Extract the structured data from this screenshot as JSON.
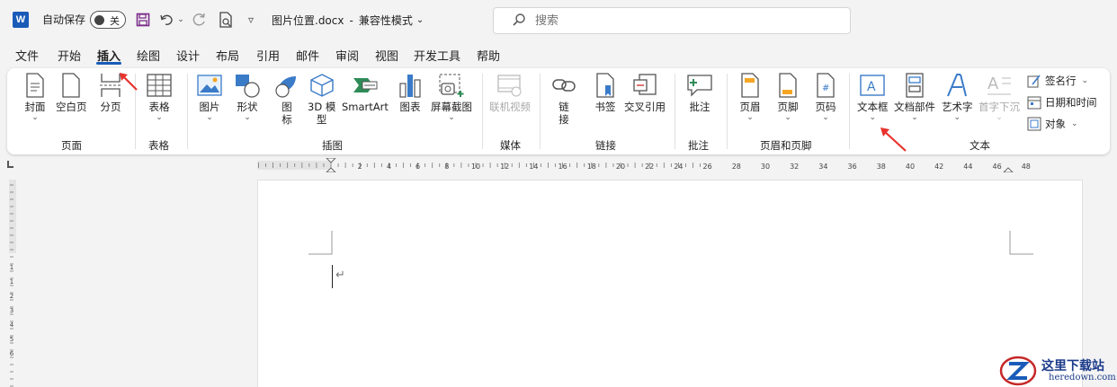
{
  "titlebar": {
    "app_letter": "W",
    "autosave_label": "自动保存",
    "autosave_state": "关",
    "doc_title": "图片位置.docx",
    "separator": "-",
    "mode": "兼容性模式",
    "search_placeholder": "搜索"
  },
  "tabs": [
    {
      "label": "文件"
    },
    {
      "label": "开始"
    },
    {
      "label": "插入",
      "active": true
    },
    {
      "label": "绘图"
    },
    {
      "label": "设计"
    },
    {
      "label": "布局"
    },
    {
      "label": "引用"
    },
    {
      "label": "邮件"
    },
    {
      "label": "审阅"
    },
    {
      "label": "视图"
    },
    {
      "label": "开发工具"
    },
    {
      "label": "帮助"
    }
  ],
  "ribbon": {
    "pages": {
      "group": "页面",
      "cover": "封面",
      "blank": "空白页",
      "break": "分页"
    },
    "tables": {
      "group": "表格",
      "table": "表格"
    },
    "illustrations": {
      "group": "插图",
      "picture": "图片",
      "shapes": "形状",
      "icons": "图\n标",
      "model_3d": "3D 模\n型",
      "smartart": "SmartArt",
      "chart": "图表",
      "screenshot": "屏幕截图"
    },
    "media": {
      "group": "媒体",
      "online_video": "联机视频"
    },
    "links": {
      "group": "链接",
      "link": "链\n接",
      "bookmark": "书签",
      "crossref": "交叉引用"
    },
    "comments": {
      "group": "批注",
      "comment": "批注"
    },
    "header_footer": {
      "group": "页眉和页脚",
      "header": "页眉",
      "footer": "页脚",
      "page_number": "页码"
    },
    "text": {
      "group": "文本",
      "textbox": "文本框",
      "quickparts": "文档部件",
      "wordart": "艺术字",
      "dropcap": "首字下沉",
      "signature": "签名行",
      "datetime": "日期和时间",
      "object": "对象"
    }
  },
  "ruler": {
    "labels": [
      "2",
      "4",
      "6",
      "8",
      "10",
      "12",
      "14",
      "16",
      "18",
      "20",
      "22",
      "24",
      "26",
      "28",
      "30",
      "32",
      "34",
      "36",
      "38",
      "40",
      "42",
      "44",
      "46",
      "48"
    ],
    "v_labels": [
      "1",
      "1",
      "2",
      "3",
      "4",
      "5",
      "6"
    ]
  },
  "watermark": {
    "title": "这里下载站",
    "url": "heredown.com"
  },
  "colors": {
    "accent": "#1a5bb8",
    "arrow": "#e8322e"
  }
}
